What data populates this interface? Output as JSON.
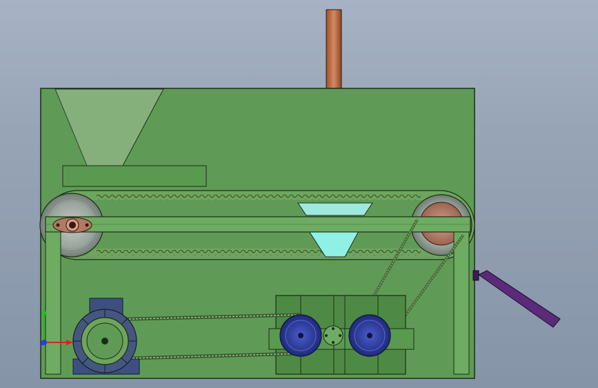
{
  "app": {
    "view_type": "cad-3d-assembly-viewport"
  },
  "colors": {
    "background_top": "#a7b3c5",
    "background_bottom": "#8594a7",
    "frame_green": "#5f9b56",
    "frame_edge": "#1a2d14",
    "belt_green": "#6fa45f",
    "gearbox_green": "#4e8a45",
    "pulley_grey": "#9ca8a0",
    "pulley_copper": "#b07a63",
    "rod_copper": "#c0704a",
    "chute_purple": "#5b2a7a",
    "wheel_blue": "#2f3f9e",
    "motor_blue": "#3d4f7e",
    "hopper_cyan": "#8ff0e6",
    "axis_x": "#e02020",
    "axis_y": "#20c020",
    "axis_z": "#2040e0"
  },
  "icons": {
    "triad": "xyz-axis-triad-icon"
  },
  "parts": [
    "frame",
    "hopper",
    "feed-plate",
    "conveyor-belt",
    "left-roller",
    "right-roller",
    "cross-beam",
    "bearing-block",
    "press-rod",
    "discharge-hopper",
    "motor",
    "motor-pulley",
    "gearbox",
    "gear-wheel-left",
    "gear-wheel-right",
    "drive-belt",
    "v-belt",
    "discharge-chute"
  ]
}
